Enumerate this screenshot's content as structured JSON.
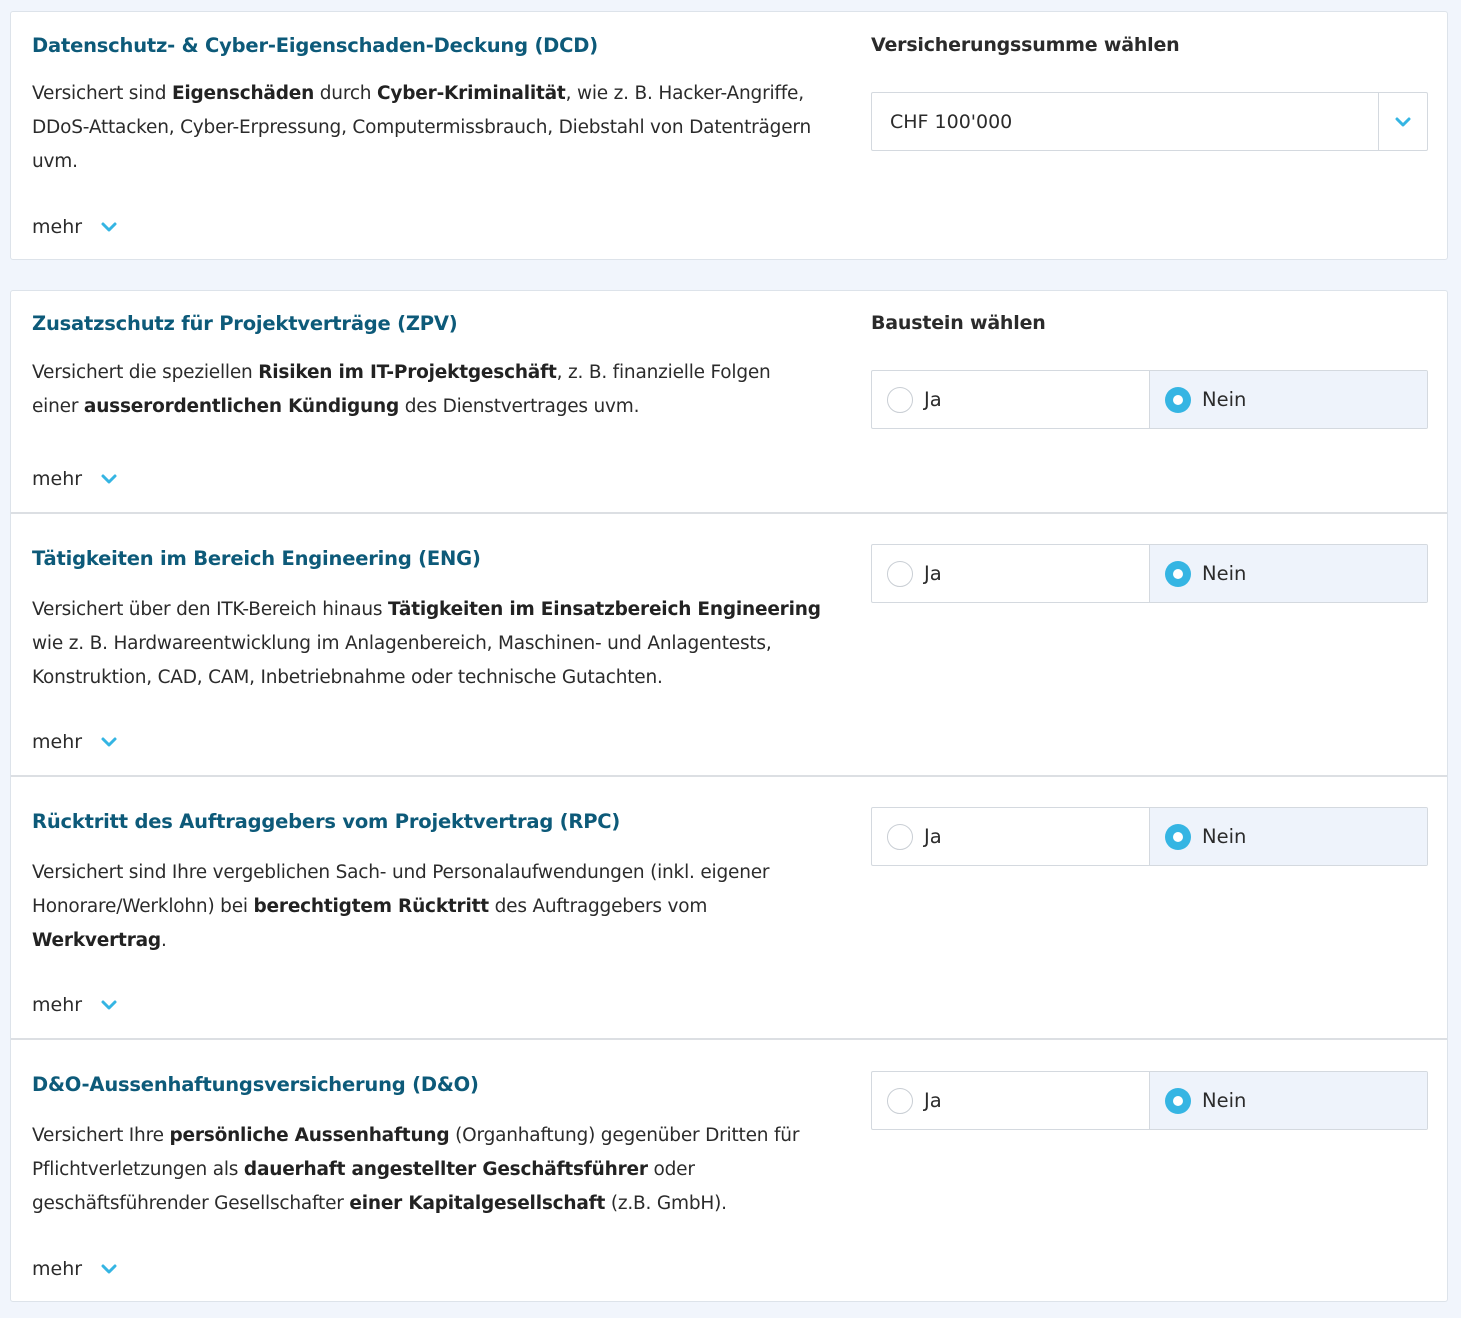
{
  "dcd": {
    "title": "Datenschutz- & Cyber-Eigenschaden-Deckung (DCD)",
    "desc_parts": [
      "Versichert sind ",
      "Eigenschäden",
      " durch ",
      "Cyber-Kriminalität",
      ", wie z. B. Hacker-Angriffe, DDoS-Attacken, Cyber-Erpressung, Computermissbrauch, Diebstahl von Datenträgern uvm."
    ],
    "more": "mehr",
    "select_label": "Versicherungssumme wählen",
    "select_value": "CHF 100'000"
  },
  "zpv": {
    "title": "Zusatzschutz für Projektverträge (ZPV)",
    "desc_parts": [
      "Versichert die speziellen ",
      "Risiken im IT-Projektgeschäft",
      ", z. B. finanzielle Folgen einer ",
      "ausserordentlichen Kündigung",
      " des Dienstvertrages uvm."
    ],
    "more": "mehr",
    "choose_label": "Baustein wählen",
    "yes": "Ja",
    "no": "Nein",
    "selected": "Nein"
  },
  "eng": {
    "title": "Tätigkeiten im Bereich Engineering (ENG)",
    "desc_parts": [
      "Versichert über den ITK-Bereich hinaus ",
      "Tätigkeiten im Einsatzbereich Engineering",
      " wie z. B. Hardwareentwicklung im Anlagenbereich, Maschinen- und Anlagentests, Konstruktion, CAD, CAM, Inbetriebnahme oder technische Gutachten."
    ],
    "more": "mehr",
    "yes": "Ja",
    "no": "Nein",
    "selected": "Nein"
  },
  "rpc": {
    "title": "Rücktritt des Auftraggebers vom Projektvertrag (RPC)",
    "desc_parts": [
      "Versichert sind Ihre vergeblichen Sach- und Personalaufwendungen (inkl. eigener Honorare/Werklohn) bei ",
      "berechtigtem Rücktritt",
      " des Auftraggebers vom ",
      "Werkvertrag",
      "."
    ],
    "more": "mehr",
    "yes": "Ja",
    "no": "Nein",
    "selected": "Nein"
  },
  "dno": {
    "title": "D&O-Aussenhaftungsversicherung (D&O)",
    "desc_parts": [
      "Versichert Ihre ",
      "persönliche Aussenhaftung",
      " (Organhaftung) gegenüber Dritten für Pflichtverletzungen als ",
      "dauerhaft angestellter Geschäftsführer",
      " oder geschäftsführender Gesellschafter ",
      "einer Kapitalgesellschaft",
      " (z.B. GmbH)."
    ],
    "more": "mehr",
    "yes": "Ja",
    "no": "Nein",
    "selected": "Nein"
  },
  "colors": {
    "title": "#0d5a79",
    "accent": "#35b5e3",
    "selected_bg": "#eef3fb",
    "page_bg": "#f1f5fc"
  },
  "icons": {
    "chevron": "chevron-down-icon",
    "radio_on": "radio-selected-icon",
    "radio_off": "radio-unselected-icon"
  }
}
